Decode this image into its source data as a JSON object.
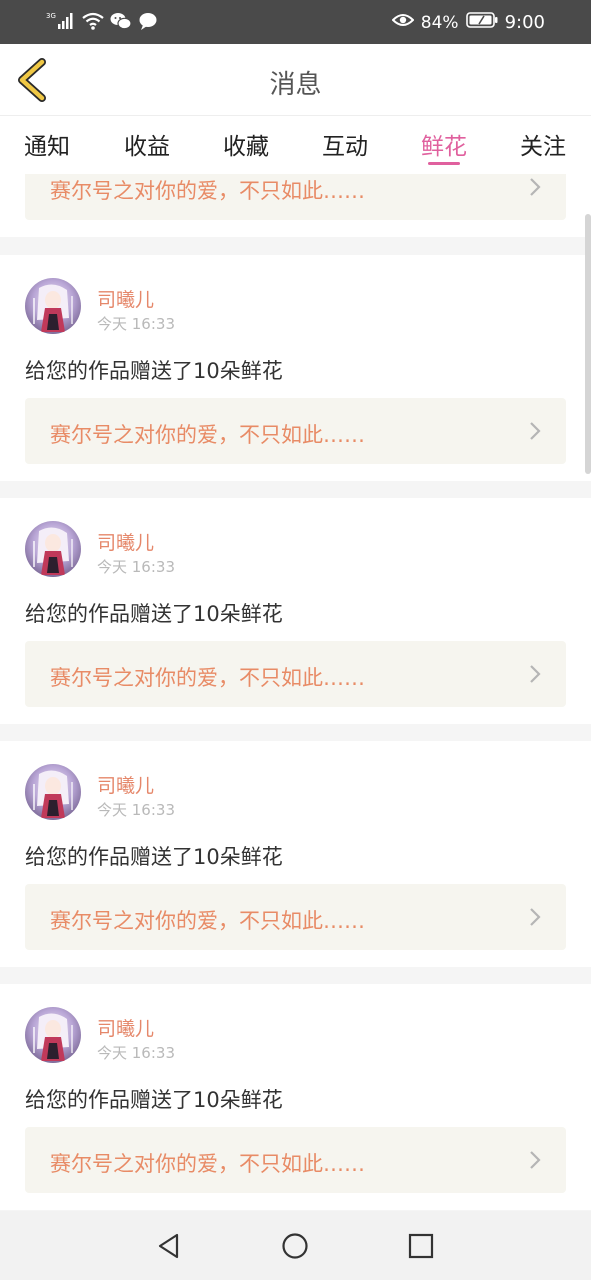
{
  "status": {
    "network": "3G",
    "battery": "84%",
    "time": "9:00",
    "icons": [
      "signal-icon",
      "wifi-icon",
      "wechat-icon",
      "message-icon",
      "eye-icon",
      "battery-icon"
    ]
  },
  "header": {
    "title": "消息",
    "back_icon": "chevron-left-icon"
  },
  "tabs": [
    {
      "label": "通知",
      "active": false
    },
    {
      "label": "收益",
      "active": false
    },
    {
      "label": "收藏",
      "active": false
    },
    {
      "label": "互动",
      "active": false
    },
    {
      "label": "鲜花",
      "active": true
    },
    {
      "label": "关注",
      "active": false
    }
  ],
  "partial_card": {
    "ref_text": "赛尔号之对你的爱，不只如此……"
  },
  "messages": [
    {
      "username": "司曦儿",
      "time": "今天 16:33",
      "text": "给您的作品赠送了10朵鲜花",
      "ref_text": "赛尔号之对你的爱，不只如此……"
    },
    {
      "username": "司曦儿",
      "time": "今天 16:33",
      "text": "给您的作品赠送了10朵鲜花",
      "ref_text": "赛尔号之对你的爱，不只如此……"
    },
    {
      "username": "司曦儿",
      "time": "今天 16:33",
      "text": "给您的作品赠送了10朵鲜花",
      "ref_text": "赛尔号之对你的爱，不只如此……"
    },
    {
      "username": "司曦儿",
      "time": "今天 16:33",
      "text": "给您的作品赠送了10朵鲜花",
      "ref_text": "赛尔号之对你的爱，不只如此……"
    }
  ],
  "colors": {
    "accent": "#e0609e",
    "username": "#e5876a",
    "ref_text": "#e88b66",
    "ref_bg": "#f6f5ef",
    "back_arrow": "#e8c24a"
  },
  "nav": [
    "back-nav-icon",
    "home-nav-icon",
    "recents-nav-icon"
  ]
}
